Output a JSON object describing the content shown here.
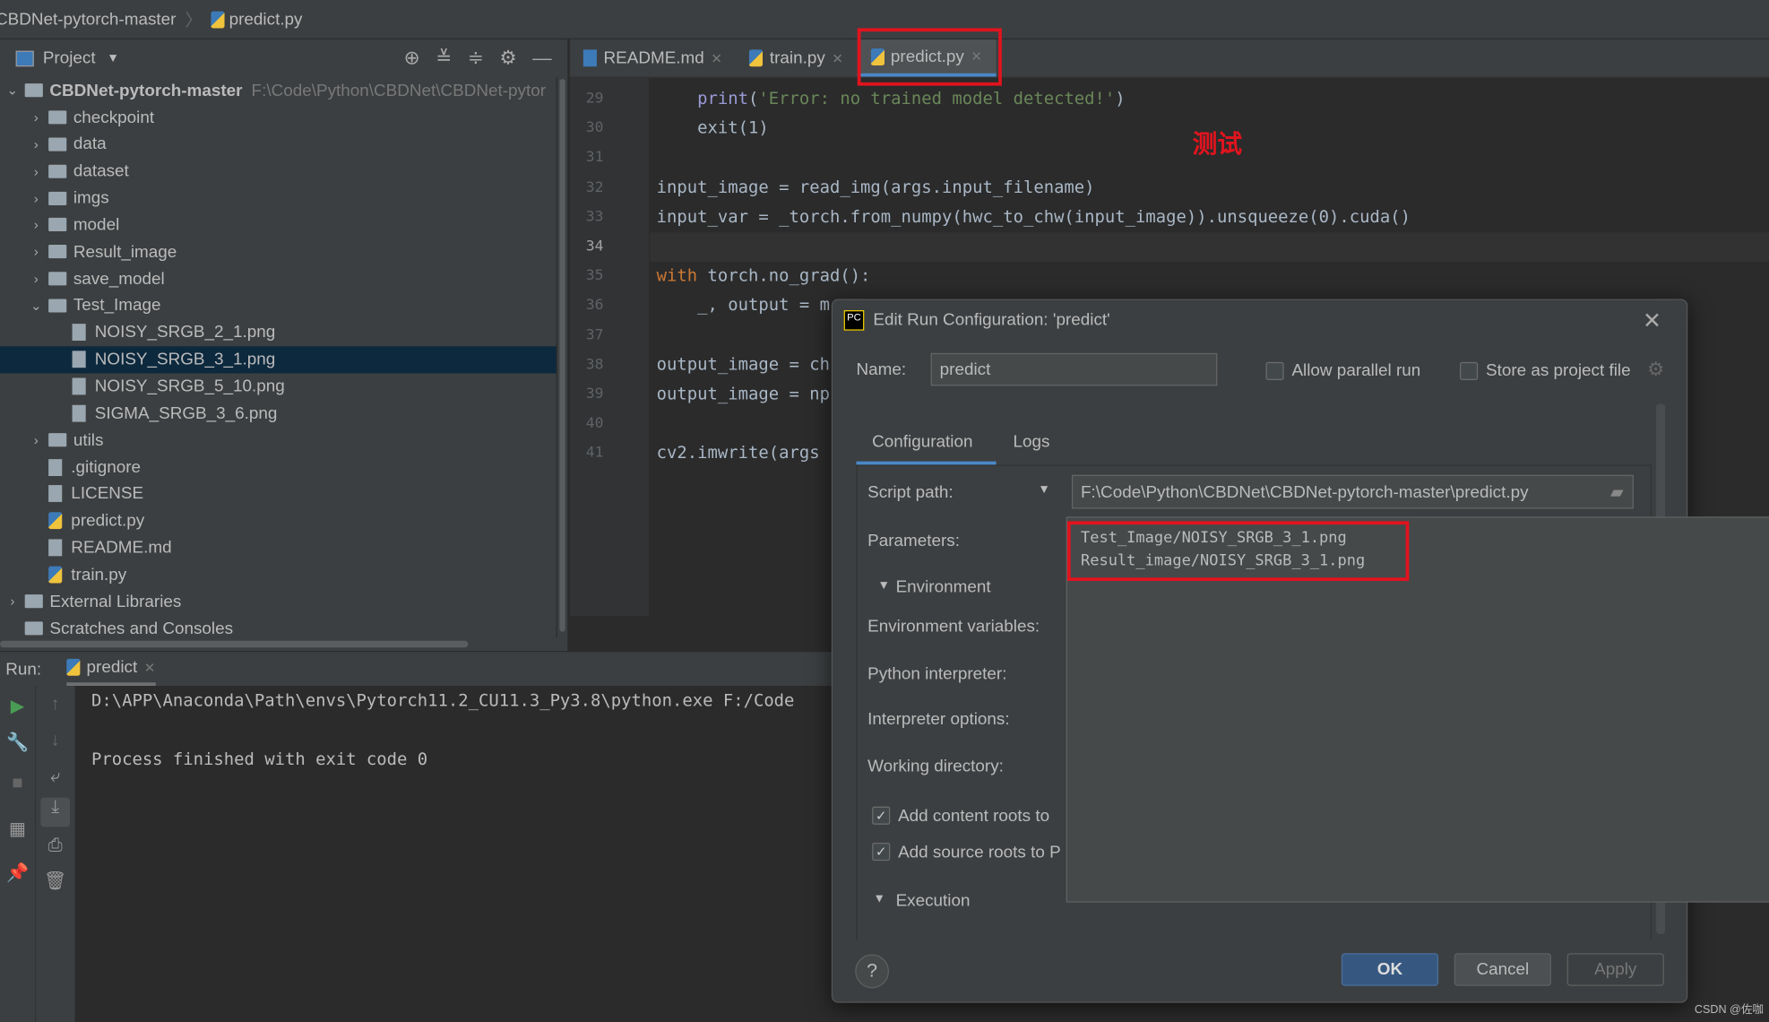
{
  "breadcrumb": {
    "project": "CBDNet-pytorch-master",
    "file": "predict.py"
  },
  "project_panel": {
    "title": "Project",
    "root": {
      "name": "CBDNet-pytorch-master",
      "path": "F:\\Code\\Python\\CBDNet\\CBDNet-pytor"
    },
    "items": [
      {
        "label": "checkpoint",
        "type": "folder"
      },
      {
        "label": "data",
        "type": "folder"
      },
      {
        "label": "dataset",
        "type": "folder"
      },
      {
        "label": "imgs",
        "type": "folder"
      },
      {
        "label": "model",
        "type": "folder"
      },
      {
        "label": "Result_image",
        "type": "folder"
      },
      {
        "label": "save_model",
        "type": "folder"
      },
      {
        "label": "Test_Image",
        "type": "folder-open"
      },
      {
        "label": "NOISY_SRGB_2_1.png",
        "type": "image"
      },
      {
        "label": "NOISY_SRGB_3_1.png",
        "type": "image",
        "selected": true
      },
      {
        "label": "NOISY_SRGB_5_10.png",
        "type": "image"
      },
      {
        "label": "SIGMA_SRGB_3_6.png",
        "type": "image"
      },
      {
        "label": "utils",
        "type": "folder"
      },
      {
        "label": ".gitignore",
        "type": "file"
      },
      {
        "label": "LICENSE",
        "type": "file"
      },
      {
        "label": "predict.py",
        "type": "python"
      },
      {
        "label": "README.md",
        "type": "markdown"
      },
      {
        "label": "train.py",
        "type": "python"
      },
      {
        "label": "External Libraries",
        "type": "library"
      },
      {
        "label": "Scratches and Consoles",
        "type": "scratch"
      }
    ]
  },
  "tabs": [
    {
      "label": "README.md"
    },
    {
      "label": "train.py"
    },
    {
      "label": "predict.py",
      "active": true
    }
  ],
  "editor": {
    "line_numbers": [
      "29",
      "30",
      "31",
      "32",
      "33",
      "34",
      "35",
      "36",
      "37",
      "38",
      "39",
      "40",
      "41"
    ],
    "lines": [
      "    print('Error: no trained model detected!')",
      "    exit(1)",
      "",
      "input_image = read_img(args.input_filename)",
      "input_var = _torch.from_numpy(hwc_to_chw(input_image)).unsqueeze(0).cuda()",
      "",
      "with torch.no_grad():",
      "    _, output = m",
      "",
      "output_image = ch",
      "output_image = np",
      "",
      "cv2.imwrite(args"
    ]
  },
  "annotation": "测试",
  "run": {
    "label": "Run:",
    "tab": "predict",
    "console": [
      "D:\\APP\\Anaconda\\Path\\envs\\Pytorch11.2_CU11.3_Py3.8\\python.exe F:/Code",
      "",
      "Process finished with exit code 0"
    ]
  },
  "dialog": {
    "title": "Edit Run Configuration: 'predict'",
    "name_label": "Name:",
    "name_value": "predict",
    "allow_parallel": "Allow parallel run",
    "store_project": "Store as project file",
    "tabs": [
      "Configuration",
      "Logs"
    ],
    "script_path_label": "Script path:",
    "script_path": "F:\\Code\\Python\\CBDNet\\CBDNet-pytorch-master\\predict.py",
    "parameters_label": "Parameters:",
    "parameters": [
      "Test_Image/NOISY_SRGB_3_1.png",
      "Result_image/NOISY_SRGB_3_1.png"
    ],
    "environment": "Environment",
    "env_vars": "Environment variables:",
    "python_interpreter": "Python interpreter:",
    "interpreter_options": "Interpreter options:",
    "working_dir": "Working directory:",
    "add_content_roots": "Add content roots to",
    "add_source_roots": "Add source roots to P",
    "execution": "Execution",
    "ok": "OK",
    "cancel": "Cancel",
    "apply": "Apply",
    "help": "?"
  },
  "watermark": "CSDN @佐咖",
  "colors": {
    "accent": "#4a88c7",
    "annotation_red": "#e0141e",
    "ok_button": "#365880"
  }
}
